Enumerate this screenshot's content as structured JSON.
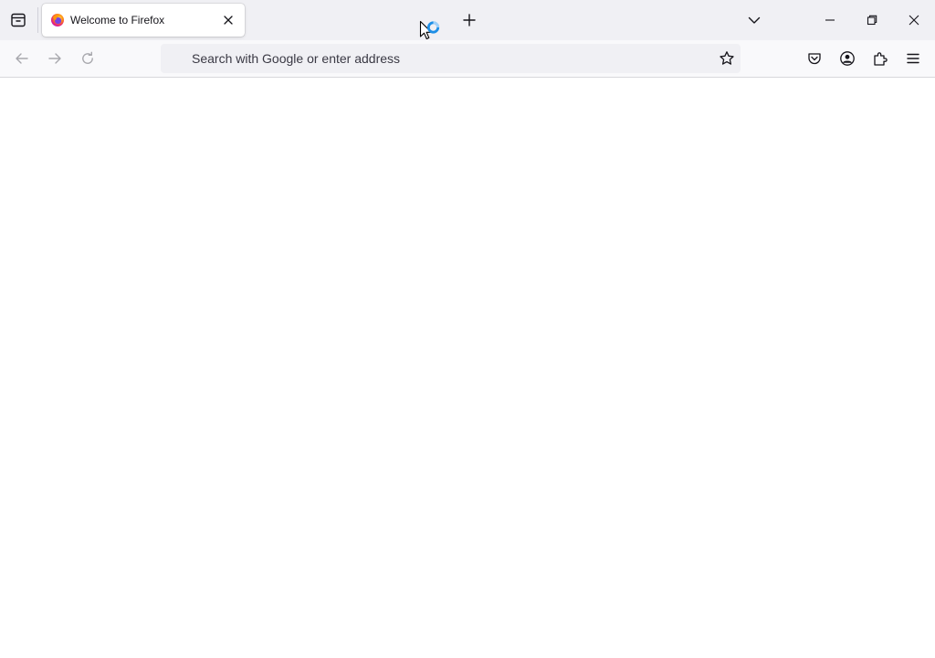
{
  "tabbar": {
    "list_all_tabs_icon": "firefox-view-icon",
    "tabs": [
      {
        "title": "Welcome to Firefox",
        "favicon": "firefox-logo-icon",
        "close_icon": "close-icon",
        "active": true
      }
    ],
    "new_tab_icon": "plus-icon",
    "tab_overflow_icon": "chevron-down-icon"
  },
  "window_controls": {
    "minimize_icon": "minimize-icon",
    "restore_icon": "restore-icon",
    "close_icon": "close-icon"
  },
  "navbar": {
    "back_icon": "back-arrow-icon",
    "forward_icon": "forward-arrow-icon",
    "reload_icon": "reload-icon",
    "urlbar": {
      "placeholder": "Search with Google or enter address",
      "value": "",
      "bookmark_icon": "star-icon"
    },
    "pocket_icon": "pocket-icon",
    "account_icon": "account-icon",
    "extensions_icon": "puzzle-icon",
    "menu_icon": "hamburger-menu-icon"
  },
  "cursor": {
    "icon": "busy-pointer-icon"
  },
  "colors": {
    "tabbar_bg": "#f0f0f4",
    "toolbar_bg": "#f9f9fb",
    "urlbar_bg": "#f0f0f4",
    "text": "#15141a",
    "busy_ring": "#1e8fe6"
  }
}
